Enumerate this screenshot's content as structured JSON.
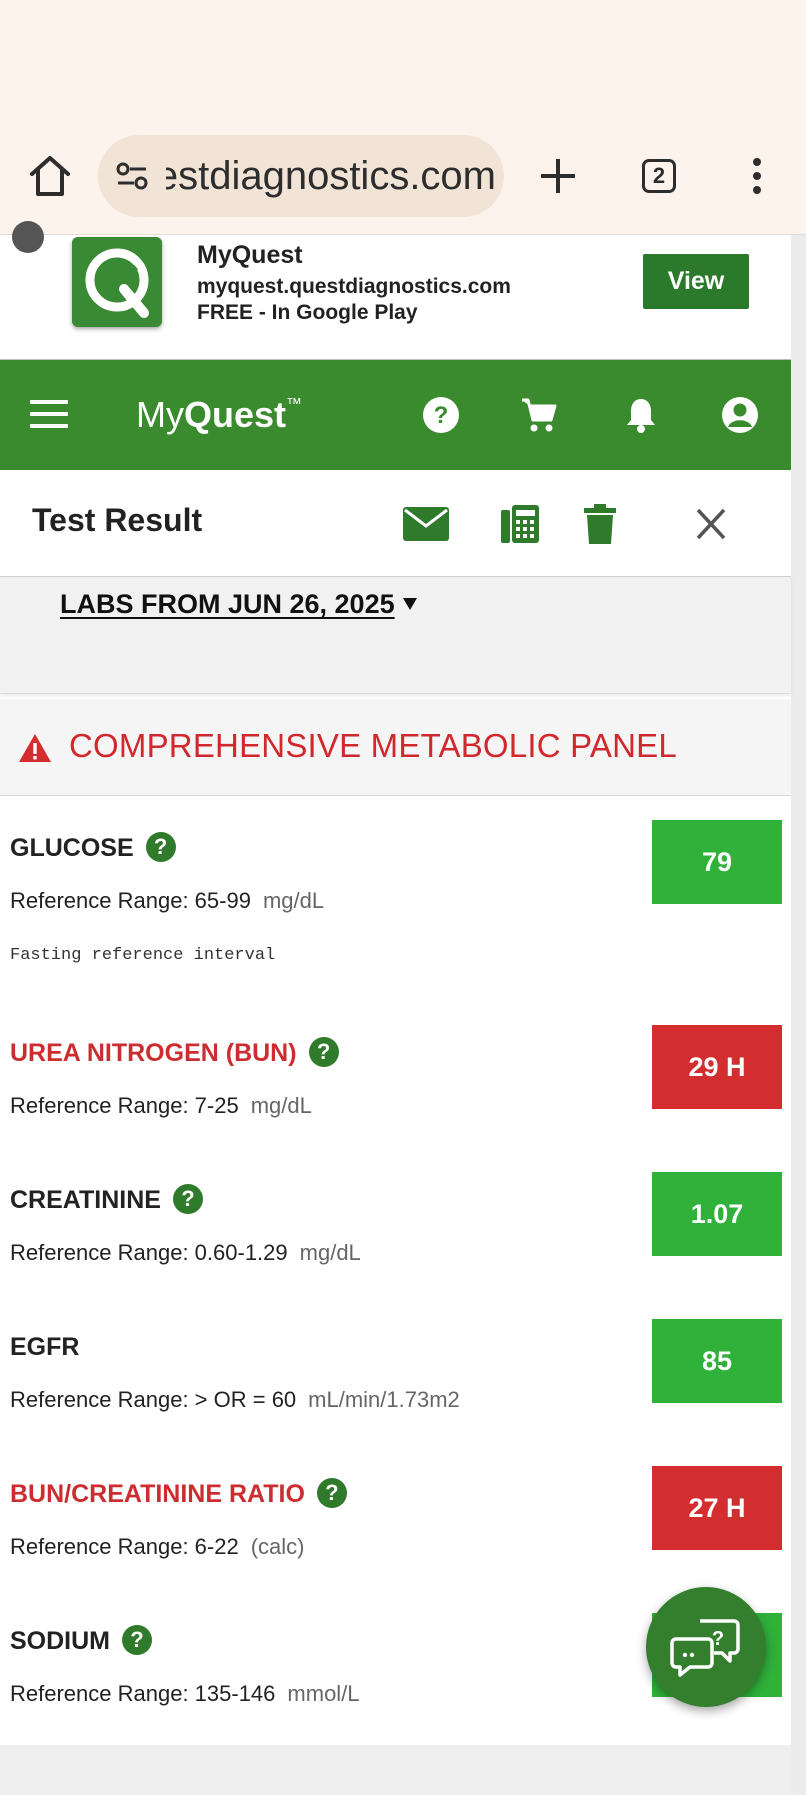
{
  "browser": {
    "url_display": "myquest.questdiagnostics.com",
    "tab_count": "2"
  },
  "app_banner": {
    "name": "MyQuest",
    "url": "myquest.questdiagnostics.com",
    "store_line": "FREE - In Google Play",
    "view_label": "View"
  },
  "nav": {
    "brand_my": "My",
    "brand_quest": "Quest",
    "brand_tm": "™"
  },
  "result_header": {
    "title": "Test Result"
  },
  "labs": {
    "date_label": "LABS FROM JUN 26, 2025"
  },
  "panel": {
    "title": "COMPREHENSIVE METABOLIC PANEL",
    "tests": [
      {
        "name": "GLUCOSE",
        "reference": "Reference Range: 65-99",
        "unit": "mg/dL",
        "value": "79",
        "note": "Fasting reference interval",
        "status": "normal"
      },
      {
        "name": "UREA NITROGEN (BUN)",
        "reference": "Reference Range: 7-25",
        "unit": "mg/dL",
        "value": "29 H",
        "status": "high"
      },
      {
        "name": "CREATININE",
        "reference": "Reference Range: 0.60-1.29",
        "unit": "mg/dL",
        "value": "1.07",
        "status": "normal"
      },
      {
        "name": "EGFR",
        "reference": "Reference Range: > OR = 60",
        "unit": "mL/min/1.73m2",
        "value": "85",
        "status": "normal"
      },
      {
        "name": "BUN/CREATININE RATIO",
        "reference": "Reference Range: 6-22",
        "unit": "(calc)",
        "value": "27 H",
        "status": "high"
      },
      {
        "name": "SODIUM",
        "reference": "Reference Range: 135-146",
        "unit": "mmol/L",
        "value": "",
        "status": "normal"
      }
    ]
  },
  "colors": {
    "brand_green": "#3a8a2e",
    "normal_green": "#2fb13a",
    "high_red": "#d42d30",
    "flag_text_red": "#cc2d31"
  },
  "icons": {
    "help": "?"
  }
}
